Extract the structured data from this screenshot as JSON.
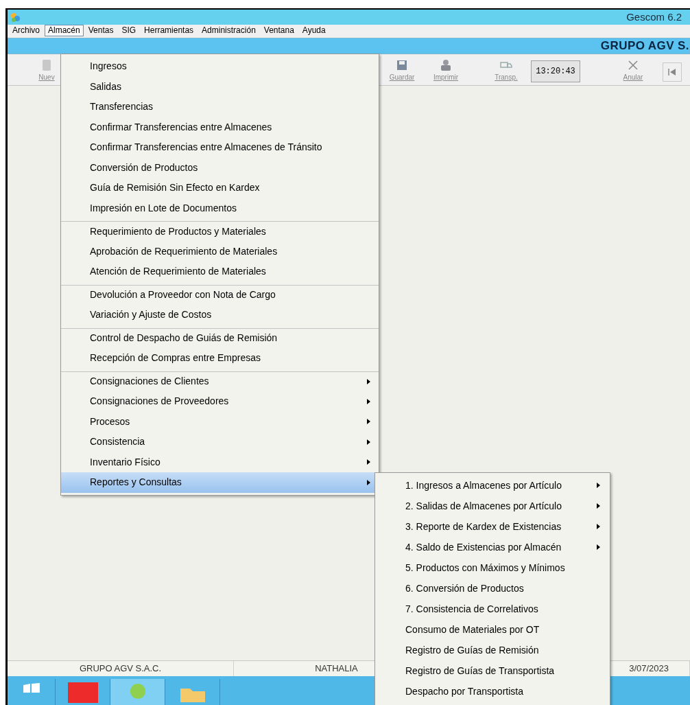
{
  "window": {
    "title": "Gescom 6.2"
  },
  "menubar": [
    {
      "label": "Archivo",
      "selected": false
    },
    {
      "label": "Almacén",
      "selected": true
    },
    {
      "label": "Ventas",
      "selected": false
    },
    {
      "label": "SIG",
      "selected": false
    },
    {
      "label": "Herramientas",
      "selected": false
    },
    {
      "label": "Administración",
      "selected": false
    },
    {
      "label": "Ventana",
      "selected": false
    },
    {
      "label": "Ayuda",
      "selected": false
    }
  ],
  "company_banner": "GRUPO AGV S.",
  "toolbar": [
    {
      "kind": "button",
      "label": "Nuev"
    },
    {
      "kind": "button",
      "label": "Guardar"
    },
    {
      "kind": "button",
      "label": "Imprimir"
    },
    {
      "kind": "button",
      "label": "Transp."
    },
    {
      "kind": "clock",
      "label": "13:20:43"
    },
    {
      "kind": "button",
      "label": "Anular"
    },
    {
      "kind": "nav"
    }
  ],
  "menu": [
    {
      "label": "Ingresos",
      "separator_before": false,
      "has_submenu": false,
      "selected": false
    },
    {
      "label": "Salidas",
      "separator_before": false,
      "has_submenu": false,
      "selected": false
    },
    {
      "label": "Transferencias",
      "separator_before": false,
      "has_submenu": false,
      "selected": false
    },
    {
      "label": "Confirmar Transferencias entre Almacenes",
      "separator_before": false,
      "has_submenu": false,
      "selected": false
    },
    {
      "label": "Confirmar Transferencias entre Almacenes de Tránsito",
      "separator_before": false,
      "has_submenu": false,
      "selected": false
    },
    {
      "label": "Conversión de Productos",
      "separator_before": false,
      "has_submenu": false,
      "selected": false
    },
    {
      "label": "Guía de Remisión Sin Efecto en Kardex",
      "separator_before": false,
      "has_submenu": false,
      "selected": false
    },
    {
      "label": "Impresión en Lote de Documentos",
      "separator_before": false,
      "has_submenu": false,
      "selected": false
    },
    {
      "label": "Requerimiento de Productos y Materiales",
      "separator_before": true,
      "has_submenu": false,
      "selected": false
    },
    {
      "label": "Aprobación de Requerimiento de Materiales",
      "separator_before": false,
      "has_submenu": false,
      "selected": false
    },
    {
      "label": "Atención de Requerimiento de Materiales",
      "separator_before": false,
      "has_submenu": false,
      "selected": false
    },
    {
      "label": "Devolución a Proveedor con Nota de Cargo",
      "separator_before": true,
      "has_submenu": false,
      "selected": false
    },
    {
      "label": "Variación y Ajuste de Costos",
      "separator_before": false,
      "has_submenu": false,
      "selected": false
    },
    {
      "label": "Control de Despacho de Guiás de Remisión",
      "separator_before": true,
      "has_submenu": false,
      "selected": false
    },
    {
      "label": "Recepción de Compras entre Empresas",
      "separator_before": false,
      "has_submenu": false,
      "selected": false
    },
    {
      "label": "Consignaciones de Clientes",
      "separator_before": true,
      "has_submenu": true,
      "selected": false
    },
    {
      "label": "Consignaciones de Proveedores",
      "separator_before": false,
      "has_submenu": true,
      "selected": false
    },
    {
      "label": "Procesos",
      "separator_before": false,
      "has_submenu": true,
      "selected": false
    },
    {
      "label": "Consistencia",
      "separator_before": false,
      "has_submenu": true,
      "selected": false
    },
    {
      "label": "Inventario Físico",
      "separator_before": false,
      "has_submenu": true,
      "selected": false
    },
    {
      "label": "Reportes y Consultas",
      "separator_before": false,
      "has_submenu": true,
      "selected": true
    }
  ],
  "submenu": [
    {
      "label": "1. Ingresos a Almacenes por Artículo",
      "has_submenu": true
    },
    {
      "label": "2. Salidas de Almacenes por Artículo",
      "has_submenu": true
    },
    {
      "label": "3. Reporte de Kardex de Existencias",
      "has_submenu": true
    },
    {
      "label": "4. Saldo de Existencias por Almacén",
      "has_submenu": true
    },
    {
      "label": "5. Productos con Máximos y Mínimos",
      "has_submenu": false
    },
    {
      "label": "6. Conversión de Productos",
      "has_submenu": false
    },
    {
      "label": "7. Consistencia de Correlativos",
      "has_submenu": false
    },
    {
      "label": "Consumo de Materiales por OT",
      "has_submenu": false
    },
    {
      "label": "Registro de Guías de Remisión",
      "has_submenu": false
    },
    {
      "label": "Registro de Guías de Transportista",
      "has_submenu": false
    },
    {
      "label": "Despacho por Transportista",
      "has_submenu": false
    }
  ],
  "status_bar": [
    "GRUPO AGV S.A.C.",
    "NATHALIA",
    "3/07/2023"
  ]
}
